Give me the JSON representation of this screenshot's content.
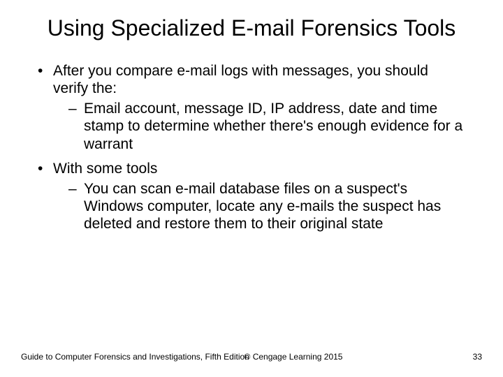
{
  "title": "Using Specialized E-mail Forensics Tools",
  "bullets": [
    {
      "text": "After you compare e-mail logs with messages, you should verify the:",
      "sub": [
        "Email account, message ID, IP address, date and time stamp to determine whether there's enough evidence for a warrant"
      ]
    },
    {
      "text": "With some tools",
      "sub": [
        "You can scan e-mail database files on a suspect's Windows computer, locate any e-mails the suspect has deleted and restore them to their original state"
      ]
    }
  ],
  "footer": {
    "left": "Guide to Computer Forensics and Investigations, Fifth Edition",
    "center": "© Cengage Learning  2015",
    "right": "33"
  }
}
